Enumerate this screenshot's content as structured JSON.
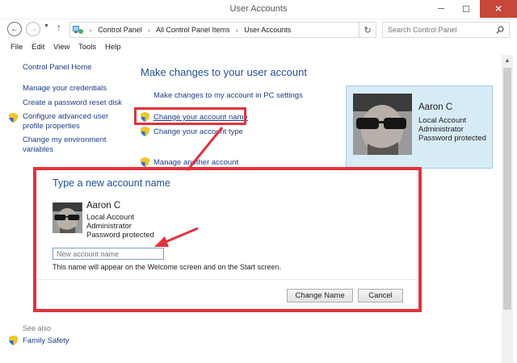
{
  "window": {
    "title": "User Accounts",
    "minimize": "─",
    "maximize": "☐",
    "close": "✕"
  },
  "nav": {
    "breadcrumbs": [
      "Control Panel",
      "All Control Panel Items",
      "User Accounts"
    ],
    "search_placeholder": "Search Control Panel"
  },
  "menu": [
    "File",
    "Edit",
    "View",
    "Tools",
    "Help"
  ],
  "sidebar": {
    "home": "Control Panel Home",
    "links": [
      "Manage your credentials",
      "Create a password reset disk",
      "Configure advanced user",
      "profile properties",
      "Change my environment",
      "variables"
    ],
    "see_also": "See also",
    "family_safety": "Family Safety"
  },
  "main": {
    "title": "Make changes to your user account",
    "pc_settings_link": "Make changes to my account in PC settings",
    "change_name_link": "Change your account name",
    "change_type_link": "Change your account type",
    "manage_another_link": "Manage another account"
  },
  "account": {
    "name": "Aaron C",
    "type": "Local Account",
    "role": "Administrator",
    "status": "Password protected"
  },
  "dialog": {
    "title": "Type a new account name",
    "input_placeholder": "New account name",
    "note": "This name will appear on the Welcome screen and on the Start screen.",
    "change_button": "Change Name",
    "cancel_button": "Cancel"
  },
  "colors": {
    "highlight": "#e0333b",
    "link": "#1f3c88",
    "title": "#1f4e9c",
    "card_bg": "#d7ebf7"
  }
}
